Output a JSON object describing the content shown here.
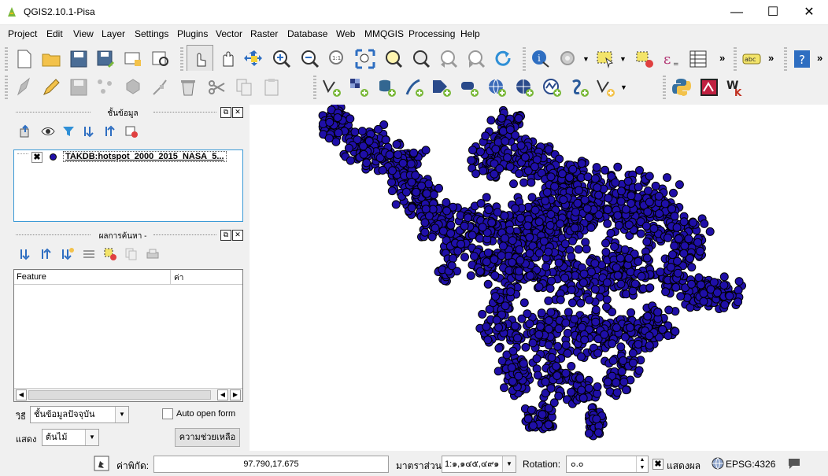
{
  "window": {
    "title": "QGIS2.10.1-Pisa",
    "minimize": "—",
    "maximize": "☐",
    "close": "✕"
  },
  "menu": [
    "Project",
    "Edit",
    "View",
    "Layer",
    "Settings",
    "Plugins",
    "Vector",
    "Raster",
    "Database",
    "Web",
    "MMQGIS",
    "Processing",
    "Help"
  ],
  "toolbar_more": "»",
  "layers_panel": {
    "title": "ชั้นข้อมูล",
    "layer_name": "TAKDB:hotspot_2000_2015_NASA_5..."
  },
  "identify_panel": {
    "title": "ผลการค้นหา -",
    "col_feature": "Feature",
    "col_value": "ค่า",
    "mode_label": "วิธี",
    "mode_value": "ชั้นข้อมูลปัจจุบัน",
    "auto_open_label": "Auto open form",
    "view_label": "แสดง",
    "view_value": "ต้นไม้",
    "help_button": "ความช่วยเหลือ"
  },
  "status": {
    "coordinate_label": "ค่าพิกัด:",
    "coordinate_value": "97.790,17.675",
    "scale_label": "มาตราส่วน",
    "scale_value": "1:๑,๑๔๕,๔๙๑",
    "rotation_label": "Rotation:",
    "rotation_value": "๐.๐",
    "render_label": "แสดงผล",
    "crs": "EPSG:4326"
  },
  "colors": {
    "point_fill": "#1f0fa8",
    "point_stroke": "#000000",
    "selection_blue": "#3c9ad6"
  }
}
